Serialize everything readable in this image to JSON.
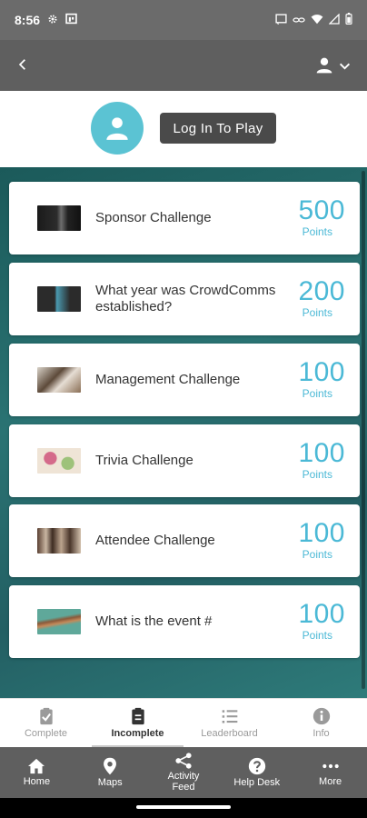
{
  "status_bar": {
    "time": "8:56"
  },
  "profile": {
    "login_label": "Log In To Play"
  },
  "challenges": [
    {
      "title": "Sponsor Challenge",
      "points": "500",
      "points_label": "Points"
    },
    {
      "title": "What year was CrowdComms established?",
      "points": "200",
      "points_label": "Points"
    },
    {
      "title": "Management Challenge",
      "points": "100",
      "points_label": "Points"
    },
    {
      "title": "Trivia Challenge",
      "points": "100",
      "points_label": "Points"
    },
    {
      "title": "Attendee Challenge",
      "points": "100",
      "points_label": "Points"
    },
    {
      "title": "What is the event #",
      "points": "100",
      "points_label": "Points"
    }
  ],
  "tabs": [
    {
      "label": "Complete",
      "icon": "clipboard-check-icon",
      "active": false
    },
    {
      "label": "Incomplete",
      "icon": "clipboard-list-icon",
      "active": true
    },
    {
      "label": "Leaderboard",
      "icon": "list-icon",
      "active": false
    },
    {
      "label": "Info",
      "icon": "info-icon",
      "active": false
    }
  ],
  "nav": [
    {
      "label": "Home",
      "icon": "home-icon"
    },
    {
      "label": "Maps",
      "icon": "map-pin-icon"
    },
    {
      "label": "Activity Feed",
      "icon": "share-icon"
    },
    {
      "label": "Help Desk",
      "icon": "help-icon"
    },
    {
      "label": "More",
      "icon": "more-icon"
    }
  ],
  "colors": {
    "accent": "#4bb9d6",
    "app_bar": "#5f5f5f",
    "avatar": "#5bc3d3",
    "teal": "#2a7373"
  }
}
